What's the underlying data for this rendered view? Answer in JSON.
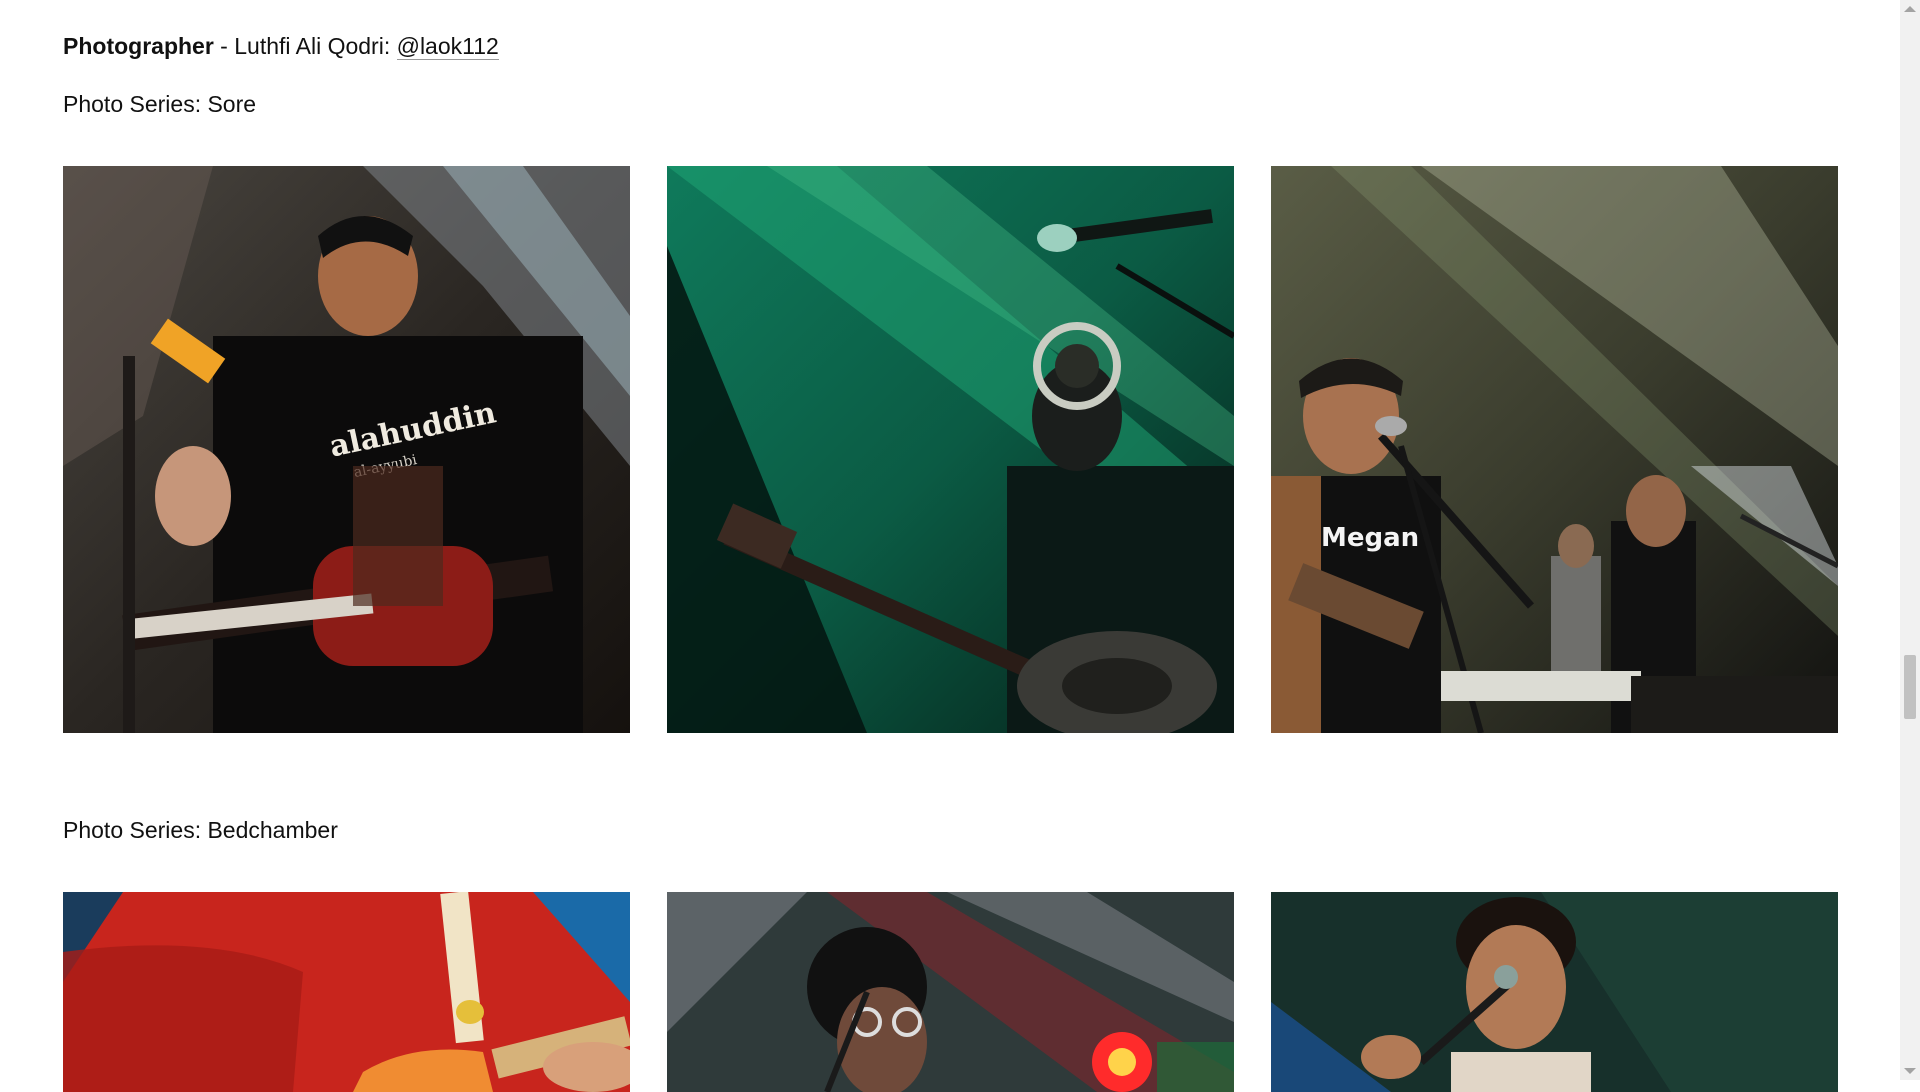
{
  "credit": {
    "role": "Photographer",
    "separator": " - ",
    "name": "Luthfi Ali Qodri: ",
    "handle": "@laok112"
  },
  "series": [
    {
      "title": "Photo Series: Sore",
      "photos": [
        {
          "icon": "photo-guitarist-red"
        },
        {
          "icon": "photo-trumpet-green"
        },
        {
          "icon": "photo-band-stage"
        }
      ]
    },
    {
      "title": "Photo Series: Bedchamber",
      "photos": [
        {
          "icon": "photo-red-shirt-guitar"
        },
        {
          "icon": "photo-glasses-red-light"
        },
        {
          "icon": "photo-singer-microphone"
        }
      ]
    }
  ],
  "photo_text": {
    "shirt": "alahuddin",
    "shirt_sub": "al-ayyubi",
    "shirt2": "Megan"
  },
  "colors": {
    "background": "#ffffff",
    "text": "#111111"
  }
}
